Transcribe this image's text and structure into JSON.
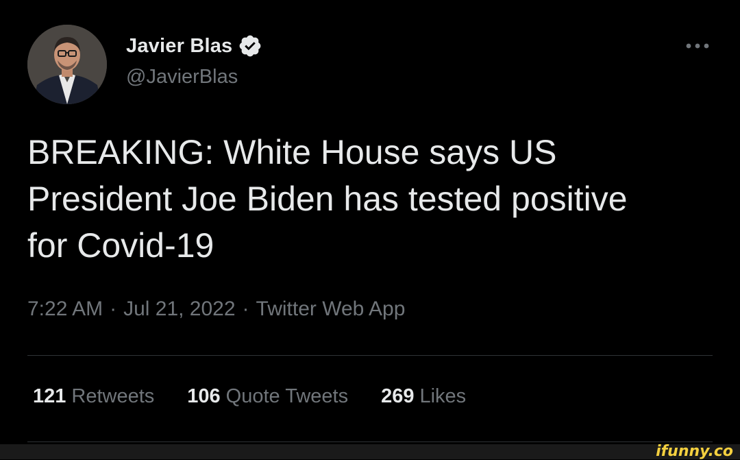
{
  "tweet": {
    "author": {
      "display_name": "Javier Blas",
      "handle": "@JavierBlas",
      "verified": true,
      "avatar_icon": "profile-photo"
    },
    "more_icon": "ellipsis-icon",
    "text": "BREAKING: White House says US\nPresident Joe Biden has tested positive\nfor Covid-19",
    "time": "7:22 AM",
    "separator": "·",
    "date": "Jul 21, 2022",
    "source": "Twitter Web App",
    "stats": {
      "retweets": {
        "count": "121",
        "label": "Retweets"
      },
      "quote_tweets": {
        "count": "106",
        "label": "Quote Tweets"
      },
      "likes": {
        "count": "269",
        "label": "Likes"
      }
    }
  },
  "watermark": "ifunny.co",
  "colors": {
    "background": "#000000",
    "text_primary": "#e7e9ea",
    "text_secondary": "#71767b",
    "divider": "#2f3336",
    "verified_badge": "#e7e9ea",
    "watermark": "#f4d03f"
  }
}
